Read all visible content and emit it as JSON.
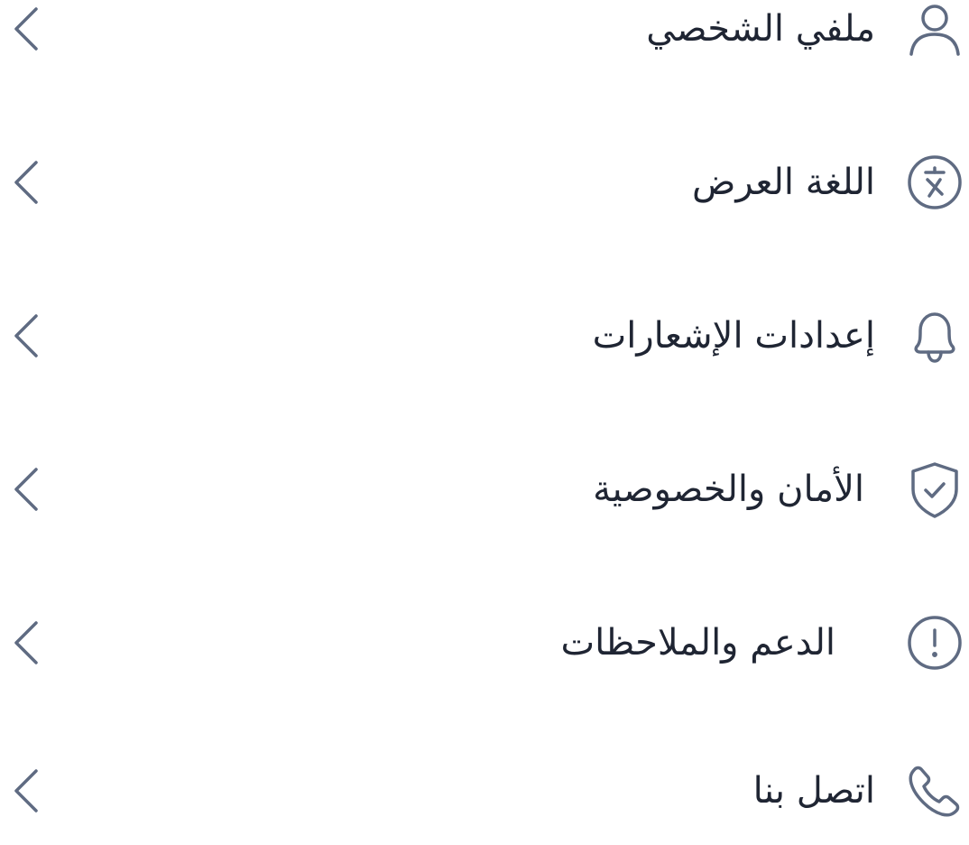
{
  "colors": {
    "icon_stroke": "#5f6b82",
    "chevron_stroke": "#5f6b82",
    "text": "#1f2533",
    "background": "#ffffff"
  },
  "menu": {
    "items": [
      {
        "label": "ملفي الشخصي",
        "icon": "user-icon"
      },
      {
        "label": "اللغة العرض",
        "icon": "translate-icon"
      },
      {
        "label": "إعدادات الإشعارات",
        "icon": "bell-icon"
      },
      {
        "label": "الأمان والخصوصية",
        "icon": "shield-check-icon"
      },
      {
        "label": "الدعم والملاحظات",
        "icon": "info-circle-icon"
      },
      {
        "label": "اتصل بنا",
        "icon": "phone-icon"
      }
    ]
  }
}
